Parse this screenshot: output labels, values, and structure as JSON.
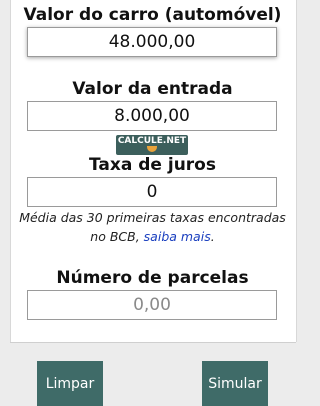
{
  "form": {
    "car_value": {
      "label": "Valor do carro (automóvel)",
      "value": "48.000,00"
    },
    "down_payment": {
      "label": "Valor da entrada",
      "value": "8.000,00"
    },
    "interest_rate": {
      "label": "Taxa de juros",
      "value": "0",
      "note_line1": "Média das 30 primeiras taxas encontradas",
      "note_line2_prefix": "no BCB, ",
      "note_link": "saiba mais",
      "note_suffix": "."
    },
    "installments": {
      "label": "Número de parcelas",
      "placeholder": "0,00"
    }
  },
  "logo": {
    "text": "CALCULE.NET"
  },
  "buttons": {
    "clear": "Limpar",
    "simulate": "Simular"
  }
}
